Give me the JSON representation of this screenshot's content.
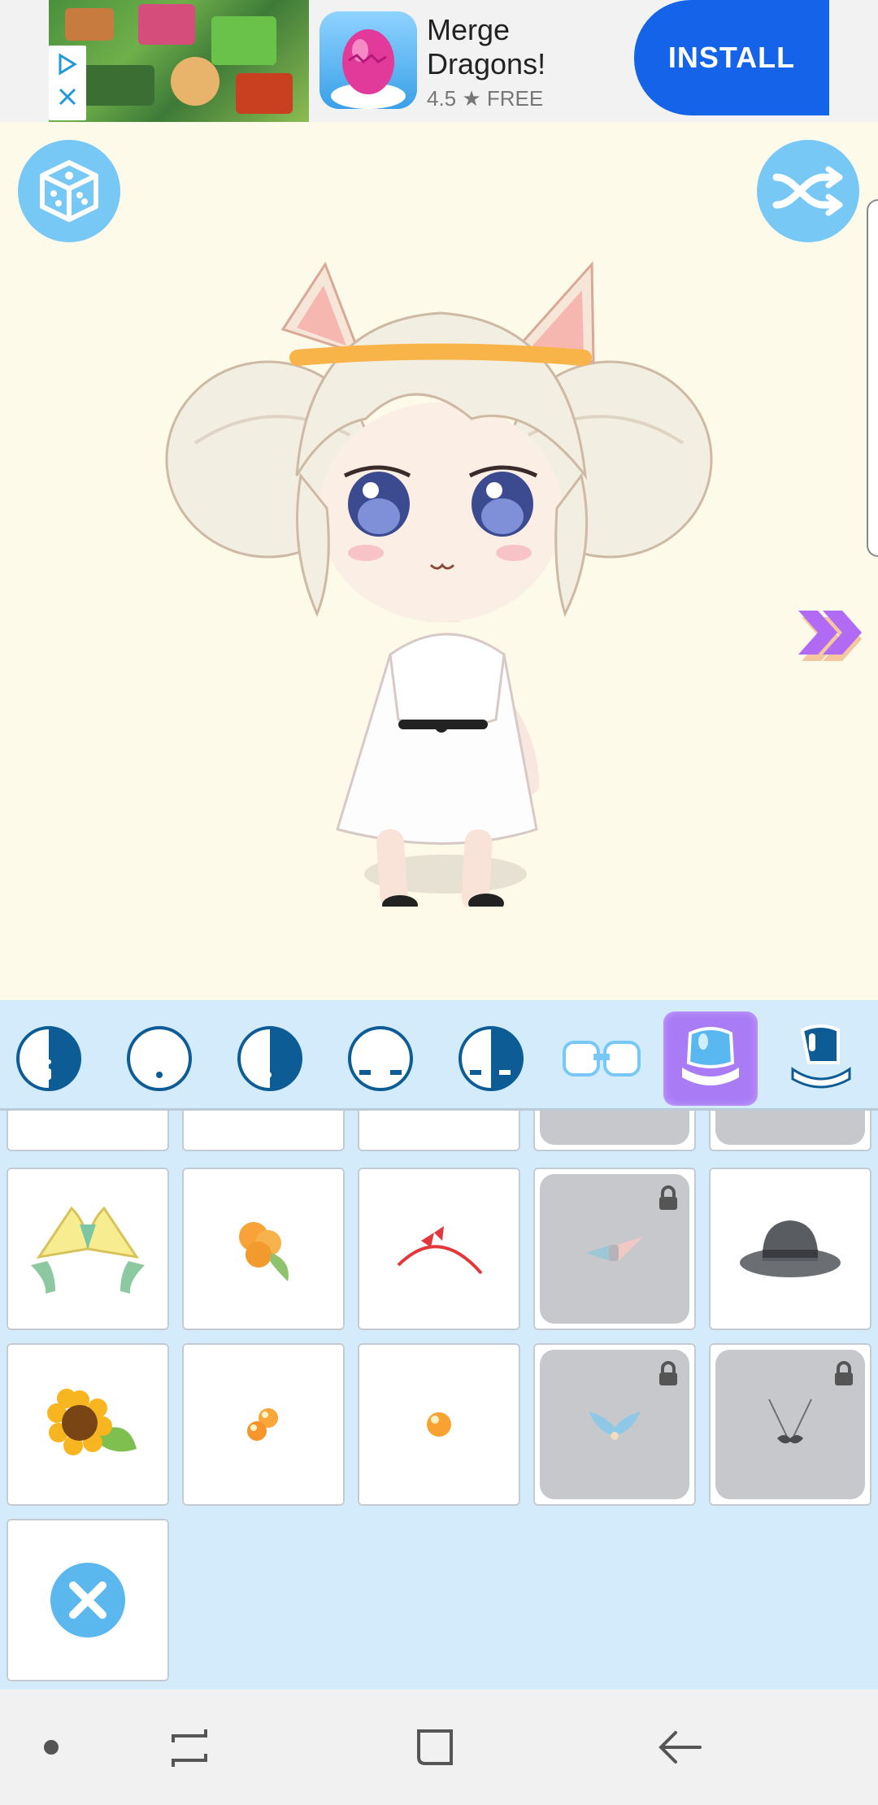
{
  "ad": {
    "title": "Merge Dragons!",
    "rating": "4.5 ★ FREE",
    "install_label": "INSTALL",
    "badge_icon": "adchoices-icon",
    "close_icon": "close-icon"
  },
  "stage": {
    "random_button_icon": "dice-icon",
    "shuffle_button_icon": "shuffle-icon",
    "next_icon": "double-chevron-right-icon"
  },
  "categories": [
    {
      "name": "face-shape-1",
      "icon": "face-icon",
      "active": false
    },
    {
      "name": "face-shape-2",
      "icon": "face-icon",
      "active": false
    },
    {
      "name": "face-shape-3",
      "icon": "face-icon",
      "active": false
    },
    {
      "name": "eyes-1",
      "icon": "eyes-icon",
      "active": false
    },
    {
      "name": "eyes-2",
      "icon": "eyes-icon",
      "active": false
    },
    {
      "name": "glasses",
      "icon": "glasses-icon",
      "active": false
    },
    {
      "name": "hat-accessory",
      "icon": "headwear-icon",
      "active": true
    },
    {
      "name": "mask",
      "icon": "mask-icon",
      "active": false
    }
  ],
  "items": [
    {
      "name": "banana-ears",
      "locked": false
    },
    {
      "name": "peach-clip",
      "locked": false
    },
    {
      "name": "red-headband",
      "locked": false
    },
    {
      "name": "bow-tie",
      "locked": true
    },
    {
      "name": "grey-fedora",
      "locked": false
    },
    {
      "name": "sunflower-clip",
      "locked": false
    },
    {
      "name": "orange-beads",
      "locked": false
    },
    {
      "name": "orange-bead",
      "locked": false
    },
    {
      "name": "fish-tail-ornament",
      "locked": true
    },
    {
      "name": "mustache-pendant",
      "locked": true
    },
    {
      "name": "remove",
      "locked": false
    }
  ],
  "colors": {
    "accent_blue": "#77c8f5",
    "selected_purple": "#a97bf5",
    "install_blue": "#1463e8",
    "panel_blue": "#d3ebfb",
    "stage_cream": "#fefaea"
  },
  "navbar": {
    "dot_icon": "home-dot-icon",
    "recents_icon": "recents-icon",
    "home_icon": "home-square-icon",
    "back_icon": "back-arrow-icon"
  }
}
